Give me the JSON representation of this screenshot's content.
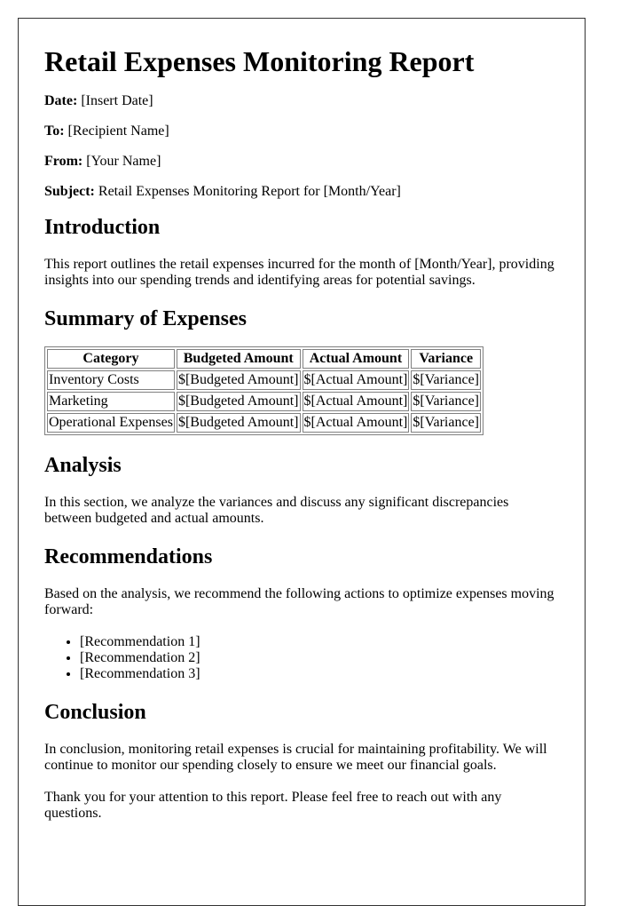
{
  "title": "Retail Expenses Monitoring Report",
  "meta": [
    {
      "label": "Date:",
      "value": "[Insert Date]"
    },
    {
      "label": "To:",
      "value": "[Recipient Name]"
    },
    {
      "label": "From:",
      "value": "[Your Name]"
    },
    {
      "label": "Subject:",
      "value": "Retail Expenses Monitoring Report for [Month/Year]"
    }
  ],
  "introduction": {
    "heading": "Introduction",
    "text": "This report outlines the retail expenses incurred for the month of [Month/Year], providing insights into our spending trends and identifying areas for potential savings."
  },
  "summary": {
    "heading": "Summary of Expenses",
    "columns": [
      "Category",
      "Budgeted Amount",
      "Actual Amount",
      "Variance"
    ],
    "rows": [
      [
        "Inventory Costs",
        "$[Budgeted Amount]",
        "$[Actual Amount]",
        "$[Variance]"
      ],
      [
        "Marketing",
        "$[Budgeted Amount]",
        "$[Actual Amount]",
        "$[Variance]"
      ],
      [
        "Operational Expenses",
        "$[Budgeted Amount]",
        "$[Actual Amount]",
        "$[Variance]"
      ]
    ]
  },
  "analysis": {
    "heading": "Analysis",
    "text": "In this section, we analyze the variances and discuss any significant discrepancies between budgeted and actual amounts."
  },
  "recommendations": {
    "heading": "Recommendations",
    "text": "Based on the analysis, we recommend the following actions to optimize expenses moving forward:",
    "items": [
      "[Recommendation 1]",
      "[Recommendation 2]",
      "[Recommendation 3]"
    ]
  },
  "conclusion": {
    "heading": "Conclusion",
    "text": "In conclusion, monitoring retail expenses is crucial for maintaining profitability. We will continue to monitor our spending closely to ensure we meet our financial goals.",
    "closing": "Thank you for your attention to this report. Please feel free to reach out with any questions."
  }
}
